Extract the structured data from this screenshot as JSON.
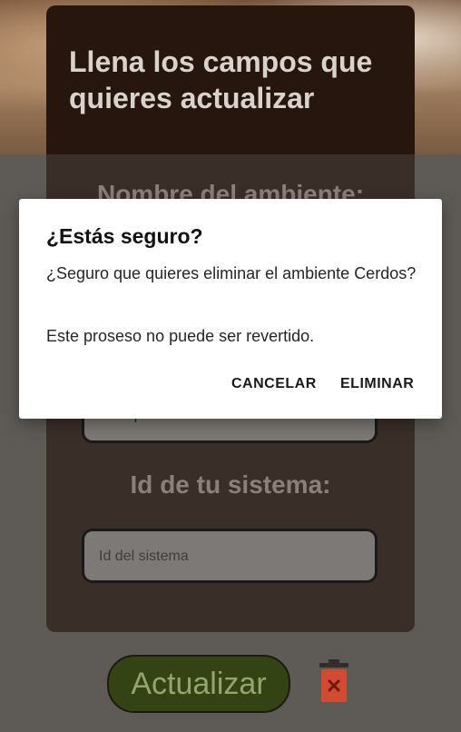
{
  "form": {
    "title": "Llena los campos que quieres actualizar",
    "name_label": "Nombre del ambiente:",
    "animal_type_placeholder": "Tipo de animal",
    "system_id_label": "Id de tu sistema:",
    "system_id_placeholder": "Id del sistema",
    "update_button": "Actualizar",
    "delete_icon": "trash-icon"
  },
  "dialog": {
    "title": "¿Estás seguro?",
    "message": "¿Seguro que quieres eliminar el ambiente Cerdos?",
    "note": "Este proseso no puede ser revertido.",
    "cancel_label": "CANCELAR",
    "confirm_label": "ELIMINAR"
  },
  "colors": {
    "card": "#26160d",
    "update_button": "#344314",
    "trash": "#d24a2f"
  }
}
